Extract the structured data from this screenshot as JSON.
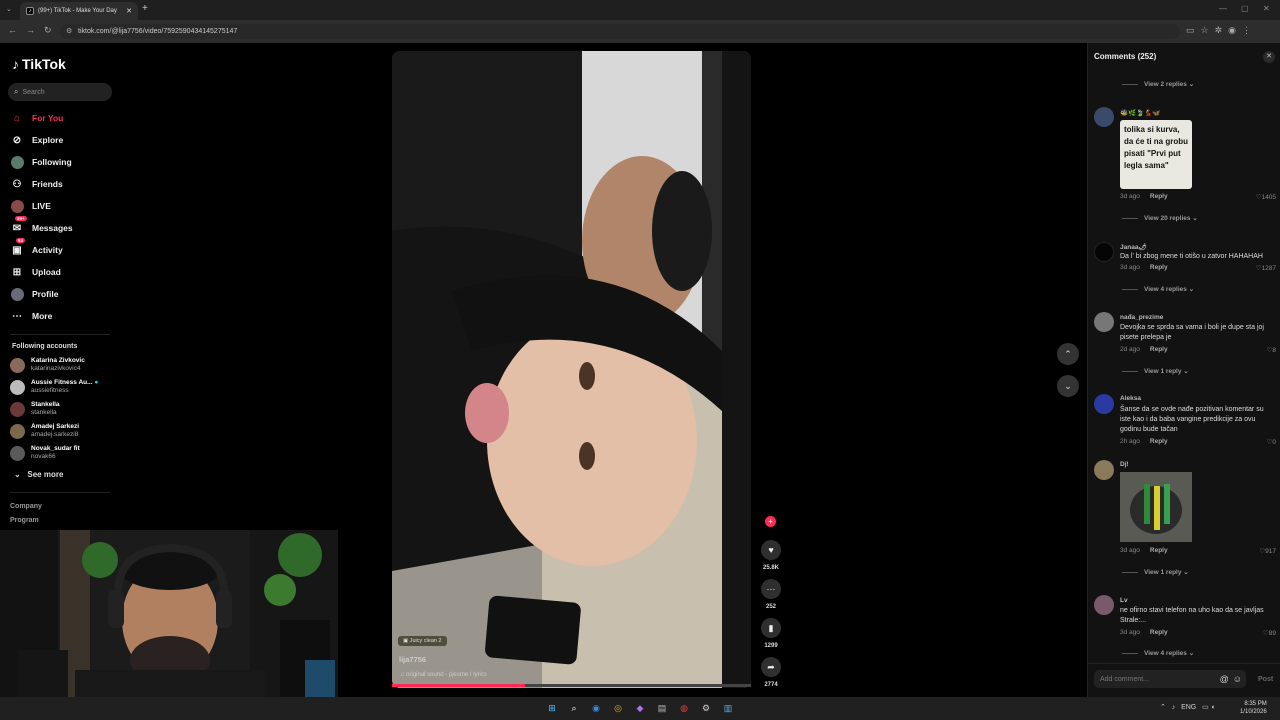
{
  "browser": {
    "tab_title": "(99+) TikTok - Make Your Day",
    "url": "tiktok.com/@lija7756/video/7592590434145275147"
  },
  "sidebar": {
    "logo": "TikTok",
    "search_placeholder": "Search",
    "nav": [
      {
        "label": "For You",
        "icon": "home-icon"
      },
      {
        "label": "Explore",
        "icon": "compass-icon"
      },
      {
        "label": "Following",
        "icon": "following-avatar-icon"
      },
      {
        "label": "Friends",
        "icon": "friends-icon"
      },
      {
        "label": "LIVE",
        "icon": "live-icon"
      },
      {
        "label": "Messages",
        "icon": "messages-icon",
        "badge": "99+"
      },
      {
        "label": "Activity",
        "icon": "activity-icon",
        "badge": "53"
      },
      {
        "label": "Upload",
        "icon": "upload-icon"
      },
      {
        "label": "Profile",
        "icon": "profile-icon"
      },
      {
        "label": "More",
        "icon": "more-icon"
      }
    ],
    "following_heading": "Following accounts",
    "following": [
      {
        "name": "Katarina Zivkovic",
        "handle": "katarinazivkovic4"
      },
      {
        "name": "Aussie Fitness Au...",
        "handle": "aussiefitness"
      },
      {
        "name": "Stankella",
        "handle": "stankella"
      },
      {
        "name": "Amadej Sarkezi",
        "handle": "amadej.sarkezi8"
      },
      {
        "name": "Novak_sudar fit",
        "handle": "novak66"
      }
    ],
    "see_more": "See more",
    "footer": [
      "Company",
      "Program"
    ]
  },
  "video": {
    "chip": "Juicy clean 2",
    "username": "lija7756",
    "sound": "original sound - pjesme / lyrics",
    "progress_fraction": 0.37
  },
  "actions": {
    "likes": "25.8K",
    "comments": "252",
    "saves": "1299",
    "shares": "2774"
  },
  "comments": {
    "title": "Comments (252)",
    "items": [
      {
        "view_replies": "View 2 replies"
      },
      {
        "user": "🐝🌿🍃💃🦋",
        "text": "",
        "sticker_text": "tolika si kurva, da će ti na grobu pisati \"Prvi put legla sama\"",
        "time": "3d ago",
        "reply": "Reply",
        "likes": "1405",
        "view_replies": "View 20 replies"
      },
      {
        "user": "Janaa🌶",
        "text": "Da l' bi zbog mene ti otišo u zatvor HAHAHAH",
        "time": "3d ago",
        "reply": "Reply",
        "likes": "1287",
        "view_replies": "View 4 replies"
      },
      {
        "user": "nađa_prezime",
        "text": "Devojka se sprda sa vama i boli je dupe sta joj pisete prelepa je",
        "time": "2d ago",
        "reply": "Reply",
        "likes": "8",
        "view_replies": "View 1 reply"
      },
      {
        "user": "Aleksa",
        "text": "Šanse da se ovde nađe pozitivan komentar su iste kao i da baba vangine predikcije za ovu godinu bude tačan",
        "time": "2h ago",
        "reply": "Reply",
        "likes": "0"
      },
      {
        "user": "Dj!",
        "text": "",
        "time": "3d ago",
        "reply": "Reply",
        "likes": "917",
        "view_replies": "View 1 reply"
      },
      {
        "user": "Lv",
        "text": "ne ofirno stavi telefon na uho kao da se javljas Strale:...",
        "time": "3d ago",
        "reply": "Reply",
        "likes": "89",
        "view_replies": "View 4 replies"
      }
    ],
    "add_placeholder": "Add comment...",
    "post": "Post"
  },
  "taskbar": {
    "lang": "ENG",
    "time": "8:35 PM",
    "date": "1/10/2026"
  },
  "colors": {
    "accent": "#fe2c55",
    "panel": "#121212",
    "bg": "#000000"
  }
}
